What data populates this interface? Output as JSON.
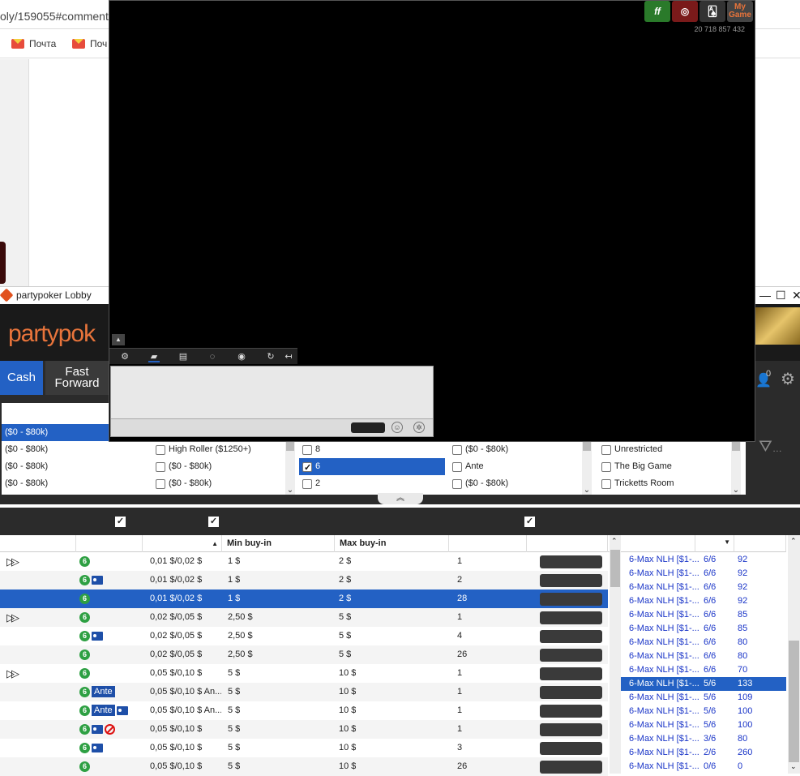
{
  "browser": {
    "url_text": "oly/159055#comment-",
    "bookmarks": [
      "Почта",
      "Поч"
    ]
  },
  "lobby": {
    "title": "partypoker Lobby",
    "brand": "partypok",
    "minimize": "—",
    "maximize": "☐",
    "close": "✕",
    "nav": {
      "cash": "Cash",
      "fast_forward_1": "Fast",
      "fast_forward_2": "Forward",
      "count": "0"
    },
    "filters": {
      "col1": [
        {
          "label": "($0 - $80k)",
          "selected": true
        },
        {
          "label": "($0 - $80k)"
        },
        {
          "label": "($0 - $80k)"
        },
        {
          "label": "($0 - $80k)"
        }
      ],
      "col2": [
        {
          "label": "High Roller ($1250+)",
          "checked": false
        },
        {
          "label": "($0 - $80k)",
          "checked": false
        },
        {
          "label": "($0 - $80k)",
          "checked": false
        }
      ],
      "col3": [
        {
          "label": "8",
          "checked": false
        },
        {
          "label": "6",
          "checked": true,
          "selected": true
        },
        {
          "label": "2",
          "checked": false
        }
      ],
      "col4": [
        {
          "label": "($0 - $80k)",
          "checked": false
        },
        {
          "label": "Ante",
          "checked": false
        },
        {
          "label": "($0 - $80k)",
          "checked": false
        }
      ],
      "col5": [
        {
          "label": "Unrestricted",
          "checked": false
        },
        {
          "label": "The Big Game",
          "checked": false
        },
        {
          "label": "Tricketts Room",
          "checked": false
        }
      ],
      "more": "…"
    },
    "table": {
      "headers": {
        "min_buyin": "Min buy-in",
        "max_buyin": "Max buy-in"
      },
      "rows": [
        {
          "ff": true,
          "icons": [
            "6"
          ],
          "stakes": "0,01 $/0,02 $",
          "min": "1 $",
          "max": "2 $",
          "players": "1"
        },
        {
          "ff": false,
          "icons": [
            "6",
            "id"
          ],
          "stakes": "0,01 $/0,02 $",
          "min": "1 $",
          "max": "2 $",
          "players": "2"
        },
        {
          "ff": false,
          "icons": [
            "6"
          ],
          "stakes": "0,01 $/0,02 $",
          "min": "1 $",
          "max": "2 $",
          "players": "28",
          "selected": true
        },
        {
          "ff": true,
          "icons": [
            "6"
          ],
          "stakes": "0,02 $/0,05 $",
          "min": "2,50 $",
          "max": "5 $",
          "players": "1"
        },
        {
          "ff": false,
          "icons": [
            "6",
            "id"
          ],
          "stakes": "0,02 $/0,05 $",
          "min": "2,50 $",
          "max": "5 $",
          "players": "4"
        },
        {
          "ff": false,
          "icons": [
            "6"
          ],
          "stakes": "0,02 $/0,05 $",
          "min": "2,50 $",
          "max": "5 $",
          "players": "26"
        },
        {
          "ff": true,
          "icons": [
            "6"
          ],
          "stakes": "0,05 $/0,10 $",
          "min": "5 $",
          "max": "10 $",
          "players": "1"
        },
        {
          "ff": false,
          "icons": [
            "6",
            "ante"
          ],
          "stakes": "0,05 $/0,10 $ An...",
          "min": "5 $",
          "max": "10 $",
          "players": "1"
        },
        {
          "ff": false,
          "icons": [
            "6",
            "ante",
            "id"
          ],
          "stakes": "0,05 $/0,10 $ An...",
          "min": "5 $",
          "max": "10 $",
          "players": "1"
        },
        {
          "ff": false,
          "icons": [
            "6",
            "id",
            "no"
          ],
          "stakes": "0,05 $/0,10 $",
          "min": "5 $",
          "max": "10 $",
          "players": "1"
        },
        {
          "ff": false,
          "icons": [
            "6",
            "id"
          ],
          "stakes": "0,05 $/0,10 $",
          "min": "5 $",
          "max": "10 $",
          "players": "3"
        },
        {
          "ff": false,
          "icons": [
            "6"
          ],
          "stakes": "0,05 $/0,10 $",
          "min": "5 $",
          "max": "10 $",
          "players": "26"
        }
      ],
      "ante_label": "Ante"
    },
    "right_list": [
      {
        "name": "6-Max NLH [$1-...",
        "seats": "6/6",
        "avg": "92"
      },
      {
        "name": "6-Max NLH [$1-...",
        "seats": "6/6",
        "avg": "92"
      },
      {
        "name": "6-Max NLH [$1-...",
        "seats": "6/6",
        "avg": "92"
      },
      {
        "name": "6-Max NLH [$1-...",
        "seats": "6/6",
        "avg": "92"
      },
      {
        "name": "6-Max NLH [$1-...",
        "seats": "6/6",
        "avg": "85"
      },
      {
        "name": "6-Max NLH [$1-...",
        "seats": "6/6",
        "avg": "85"
      },
      {
        "name": "6-Max NLH [$1-...",
        "seats": "6/6",
        "avg": "80"
      },
      {
        "name": "6-Max NLH [$1-...",
        "seats": "6/6",
        "avg": "80"
      },
      {
        "name": "6-Max NLH [$1-...",
        "seats": "6/6",
        "avg": "70"
      },
      {
        "name": "6-Max NLH [$1-...",
        "seats": "5/6",
        "avg": "133",
        "selected": true
      },
      {
        "name": "6-Max NLH [$1-...",
        "seats": "5/6",
        "avg": "109"
      },
      {
        "name": "6-Max NLH [$1-...",
        "seats": "5/6",
        "avg": "100"
      },
      {
        "name": "6-Max NLH [$1-...",
        "seats": "5/6",
        "avg": "100"
      },
      {
        "name": "6-Max NLH [$1-...",
        "seats": "3/6",
        "avg": "80"
      },
      {
        "name": "6-Max NLH [$1-...",
        "seats": "2/6",
        "avg": "260"
      },
      {
        "name": "6-Max NLH [$1-...",
        "seats": "0/6",
        "avg": "0"
      }
    ]
  },
  "game_window": {
    "logos": [
      "ff",
      "",
      "",
      "My Game"
    ],
    "counter": "20 718 857 432"
  },
  "colors": {
    "accent": "#2361c4",
    "brand": "#e8743b",
    "seat_badge": "#2ea043"
  }
}
